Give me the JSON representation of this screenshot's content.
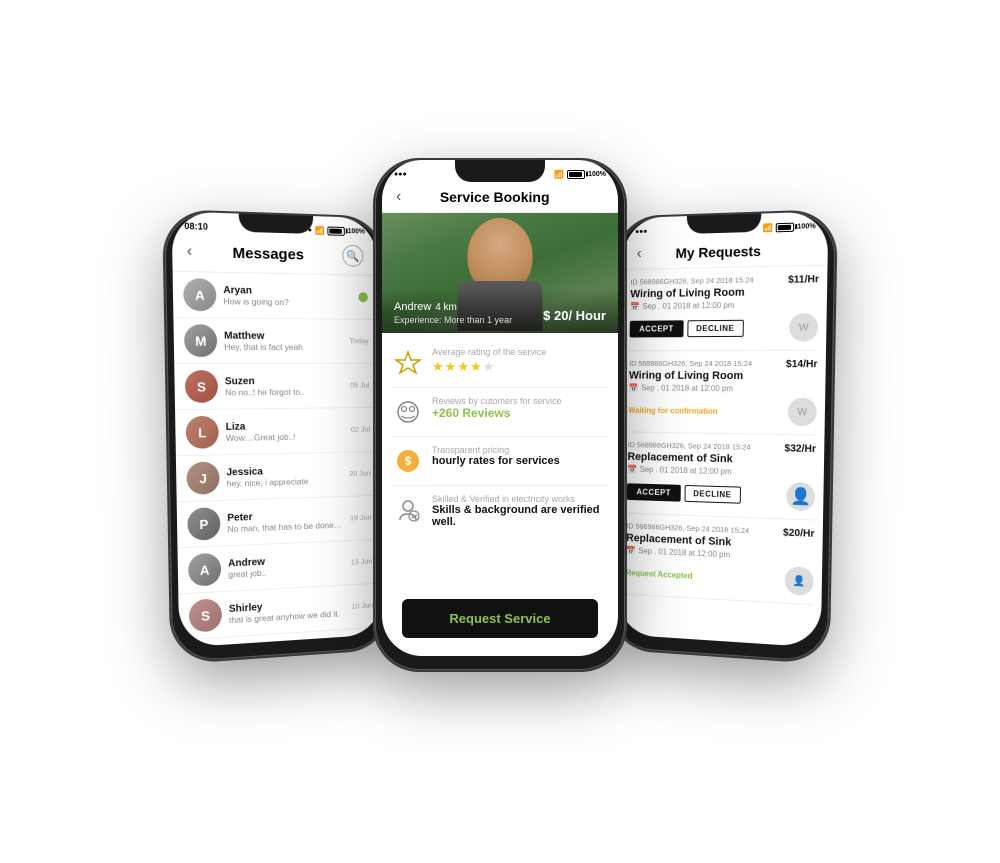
{
  "left_phone": {
    "status": "100%",
    "title": "Messages",
    "time": "08:10",
    "messages": [
      {
        "name": "Aryan",
        "preview": "How is going on?",
        "date": "",
        "has_dot": true,
        "avatar_class": "av-aryan"
      },
      {
        "name": "Matthew",
        "preview": "Hey, that is fact yeah",
        "date": "Today",
        "has_dot": false,
        "avatar_class": "av-matthew"
      },
      {
        "name": "Suzen",
        "preview": "No no..! he forgot to..",
        "date": "05 Jul",
        "has_dot": false,
        "avatar_class": "av-suzen"
      },
      {
        "name": "Liza",
        "preview": "Wow....Great job..!",
        "date": "02 Jul",
        "has_dot": false,
        "avatar_class": "av-liza"
      },
      {
        "name": "Jessica",
        "preview": "hey, nice, i appreciate",
        "date": "20 Jun",
        "has_dot": false,
        "avatar_class": "av-jessica"
      },
      {
        "name": "Peter",
        "preview": "No man, that has to be done by today only",
        "date": "16 Jun",
        "has_dot": false,
        "avatar_class": "av-peter"
      },
      {
        "name": "Andrew",
        "preview": "great job..",
        "date": "13 Jun",
        "has_dot": false,
        "avatar_class": "av-andrew"
      },
      {
        "name": "Shirley",
        "preview": "that is great anyhow we did it.",
        "date": "10 Jun",
        "has_dot": false,
        "avatar_class": "av-shirley"
      }
    ]
  },
  "center_phone": {
    "status": "100%",
    "title": "Service Booking",
    "provider_name": "Andrew",
    "provider_distance": "4 km",
    "provider_experience": "Experience: More than 1 year",
    "provider_price": "$ 20/ Hour",
    "sections": [
      {
        "icon": "star",
        "label": "Average rating of the service",
        "value": "",
        "stars": [
          true,
          true,
          true,
          true,
          false
        ],
        "type": "rating"
      },
      {
        "icon": "review",
        "label": "Reviews by cutomers for service",
        "value": "+260 Reviews",
        "type": "reviews"
      },
      {
        "icon": "price",
        "label": "Transparent pricing",
        "value": "hourly rates for services",
        "type": "pricing"
      },
      {
        "icon": "verified",
        "label": "Skilled & Verified  in electricity works",
        "value": "Skills & background are verified well.",
        "type": "skills"
      }
    ],
    "button_label": "Request Service"
  },
  "right_phone": {
    "status": "100%",
    "title": "My Requests",
    "requests": [
      {
        "id": "ID 568986GH326, Sep 24 2018 15:24",
        "name": "Wiring of Living Room",
        "price": "$11/Hr",
        "date": "Sep . 01 2018 at 12:00 pm",
        "status": "accept_decline",
        "has_avatar": true,
        "avatar_class": "av-andrew"
      },
      {
        "id": "ID 568986GH326, Sep 24 2018 15:24",
        "name": "Wiring of Living Room",
        "price": "$14/Hr",
        "date": "Sep . 01 2018 at 12:00 pm",
        "status": "waiting",
        "status_text": "Waiting for confirmation",
        "has_avatar": true,
        "avatar_class": "av-matthew"
      },
      {
        "id": "ID 568986GH326, Sep 24 2018 15:24",
        "name": "Replacement of Sink",
        "price": "$32/Hr",
        "date": "Sep . 01 2018 at 12:00 pm",
        "status": "accept_decline",
        "has_avatar": false
      },
      {
        "id": "ID 568986GH326, Sep 24 2018 15:24",
        "name": "Replacement of Sink",
        "price": "$20/Hr",
        "date": "Sep . 01 2018 at 12:00 pm",
        "status": "accepted",
        "status_text": "Request Accepted",
        "has_avatar": false
      }
    ],
    "accept_label": "ACCEPT",
    "decline_label": "DECLINE"
  }
}
